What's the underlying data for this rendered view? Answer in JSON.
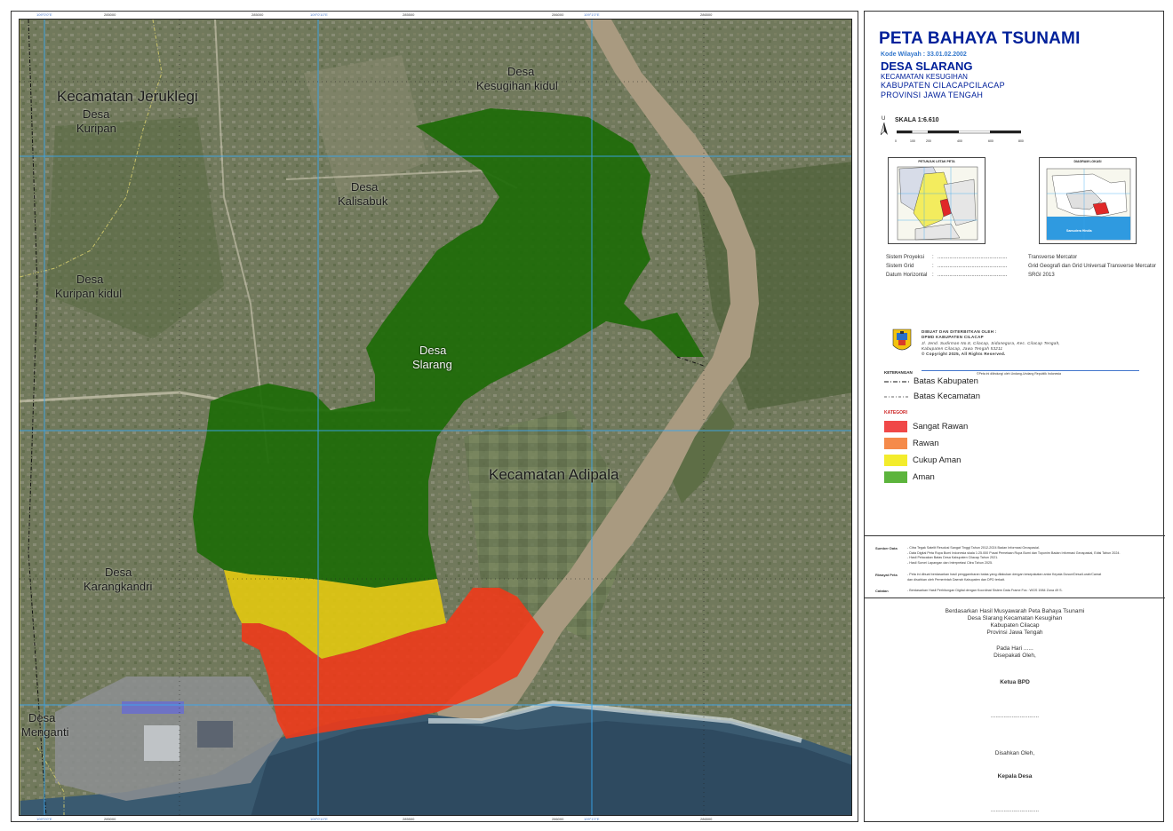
{
  "map": {
    "labels": {
      "kec_jeruklegi": "Kecamatan Jeruklegi",
      "desa_kuripan_1": "Desa",
      "desa_kuripan_2": "Kuripan",
      "desa_kesugihan_1": "Desa",
      "desa_kesugihan_2": "Kesugihan kidul",
      "desa_kalisabuk_1": "Desa",
      "desa_kalisabuk_2": "Kalisabuk",
      "desa_kuripankidul_1": "Desa",
      "desa_kuripankidul_2": "Kuripan kidul",
      "desa_slarang_1": "Desa",
      "desa_slarang_2": "Slarang",
      "kec_adipala": "Kecamatan Adipala",
      "desa_karangkandri_1": "Desa",
      "desa_karangkandri_2": "Karangkandri",
      "desa_menganti_1": "Desa",
      "desa_menganti_2": "Menganti"
    },
    "grid_labels_top": [
      "109°0'0\"E",
      "285000",
      "109°0'10\"E",
      "285000",
      "109°1'0\"E",
      "285500",
      "109°1'0\"E",
      "286000",
      "109°2'0\"E",
      "286500"
    ],
    "grid_labels_bottom": [
      "109°0'0\"E",
      "285000",
      "109°0'10\"E",
      "285500",
      "109°1'0\"E",
      "286000",
      "109°2'0\"E",
      "286500"
    ]
  },
  "legend": {
    "title": "PETA BAHAYA TSUNAMI",
    "kode": "Kode Wilayah : 33.01.02.2002",
    "desa": "DESA SLARANG",
    "kecamatan": "KECAMATAN KESUGIHAN",
    "kabupaten": "KABUPATEN CILACAPCILACAP",
    "provinsi": "PROVINSI JAWA TENGAH",
    "north_letter": "U",
    "scale": "SKALA 1:6.610",
    "scale_ticks": [
      "0",
      "100",
      "200",
      "400",
      "600",
      "800"
    ],
    "inset1_title": "PETUNJUK LETAK PETA",
    "inset2_title": "DIAGRAM LOKASI",
    "inset2_sea": "Samudera Hindia",
    "projection": [
      {
        "key": "Sistem Proyeksi",
        "colon": ":",
        "dots": "...............................................",
        "value": "Transverse Mercator"
      },
      {
        "key": "Sistem Grid",
        "colon": ":",
        "dots": "...............................................",
        "value": "Grid Geografi dan Grid Universal Transverse Mercator"
      },
      {
        "key": "Datum Horizontal",
        "colon": ":",
        "dots": "...............................................",
        "value": "SRGI 2013"
      }
    ],
    "publisher": {
      "line1": "DIBUAT DAN DITERBITKAN OLEH :",
      "line2": "DPMD KABUPATEN CILACAP",
      "line3": "Jl. Jend. Sudirman No.8, Cilacap, Sidanegara, Kec. Cilacap Tengah,",
      "line4": "Kabupaten Cilacap, Jawa Tengah 53211",
      "line5": "© Copyright 2025, All Rights Reserved.",
      "note": "©Peta ini dilindungi oleh Undang-Undang Republik Indonesia"
    },
    "keterangan_title": "KETERANGAN",
    "batas_kabupaten": "Batas Kabupaten",
    "batas_kecamatan": "Batas Kecamatan",
    "kategori_title": "KATEGORI",
    "categories": [
      {
        "label": "Sangat Rawan",
        "color": "#f04848"
      },
      {
        "label": "Rawan",
        "color": "#f58a4a"
      },
      {
        "label": "Cukup Aman",
        "color": "#f3ec2c"
      },
      {
        "label": "Aman",
        "color": "#5cb43c"
      }
    ],
    "notes": {
      "sumber_key": "Sumber Data",
      "sumber": [
        "- Citra Tegak Satelit Resolusi Sangat Tinggi Tahun 2012-2024 Badan Informasi Geospasial.",
        "- Data Digital Peta Rupa Bumi Indonesia skala 1:25.000 Pusat Pemetaan Rupa Bumi dan Toponim Badan Informasi Geospasial, Edisi Tahun 2024.",
        "- Hasil Pelacakan Batas Desa Kabupaten Cilacap Tahun 2021.",
        "- Hasil Survei Lapangan dan Interpretasi Citra Tahun 2025."
      ],
      "riwayat_key": "Riwayat Peta",
      "riwayat": [
        "- Peta ini dibuat berdasarkan hasil penggambaran batas yang dilakukan dengan kesepakatan antar Kepala Dusun/Desa/Lurah/Camat",
        "  dan disahkan oleh Pemerintah Daerah Kabupaten dan DPD terkait."
      ],
      "catatan_key": "Catatan",
      "catatan": "- Berdasarkan Hasil Perhitungan Digital dengan Koordinat Sistem Data Frame Fcs : WGS 1984 Zona 49 S."
    },
    "sign": {
      "l1": "Berdasarkan Hasil Musyawarah Peta Bahaya Tsunami",
      "l2": "Desa Slarang Kecamatan Kesugihan",
      "l3": "Kabupaten Cilacap",
      "l4": "Provinsi Jawa Tengah",
      "l5": "Pada Hari ......",
      "l6": "Disepakati Oleh,",
      "l7": "Ketua BPD",
      "l8": "..............................",
      "l9": "Disahkan Oleh,",
      "l10": "Kepala Desa",
      "l11": ".............................."
    }
  }
}
